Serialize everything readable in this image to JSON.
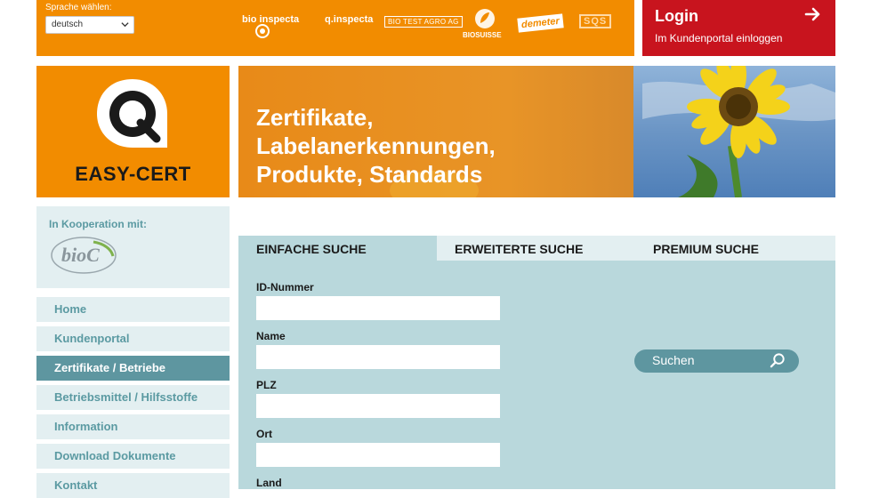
{
  "header": {
    "language_label": "Sprache wählen:",
    "language_selected": "deutsch",
    "partners": {
      "bio_inspecta": "bio inspecta",
      "q_inspecta": "q.inspecta",
      "bio_test_agro": "BIO TEST AGRO AG",
      "bio_suisse": "BIOSUISSE",
      "demeter": "demeter",
      "sqs": "SQS"
    }
  },
  "login": {
    "title": "Login",
    "subtitle": "Im Kundenportal einloggen"
  },
  "logo": {
    "text": "EASY-CERT"
  },
  "banner": {
    "line1": "Zertifikate,",
    "line2": "Labelanerkennungen,",
    "line3": "Produkte, Standards"
  },
  "sidebar": {
    "cooperation_label": "In Kooperation mit:",
    "cooperation_logo_text": "bioC",
    "items": [
      {
        "label": "Home"
      },
      {
        "label": "Kundenportal"
      },
      {
        "label": "Zertifikate / Betriebe"
      },
      {
        "label": "Betriebsmittel / Hilfsstoffe"
      },
      {
        "label": "Information"
      },
      {
        "label": "Download Dokumente"
      },
      {
        "label": "Kontakt"
      }
    ]
  },
  "search": {
    "tabs": [
      {
        "label": "EINFACHE SUCHE"
      },
      {
        "label": "ERWEITERTE SUCHE"
      },
      {
        "label": "PREMIUM SUCHE"
      }
    ],
    "fields": [
      {
        "label": "ID-Nummer"
      },
      {
        "label": "Name"
      },
      {
        "label": "PLZ"
      },
      {
        "label": "Ort"
      },
      {
        "label": "Land"
      }
    ],
    "button_label": "Suchen"
  },
  "colors": {
    "orange": "#f28c00",
    "red": "#c8141e",
    "teal": "#5e96a0",
    "panel": "#b9d8dc",
    "light": "#e3eff1"
  }
}
